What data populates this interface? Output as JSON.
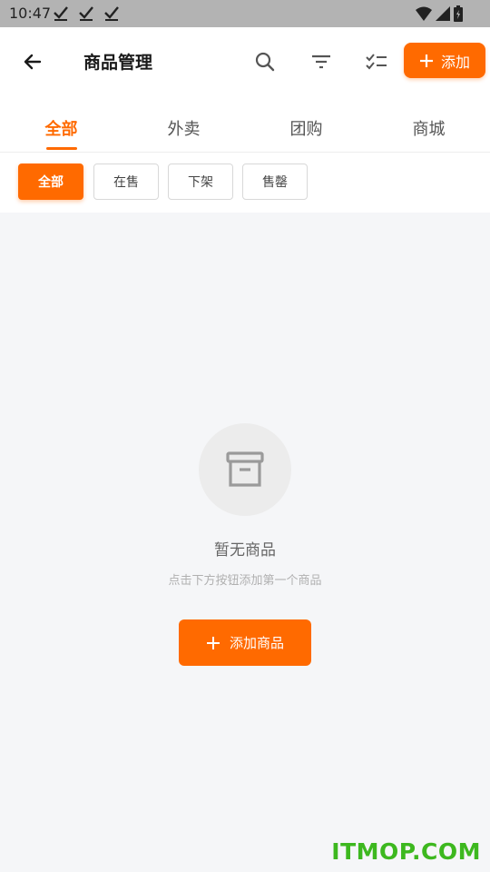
{
  "status_bar": {
    "time": "10:47",
    "check_icons": [
      "check-icon",
      "check-icon",
      "check-icon"
    ],
    "right_icons": [
      "wifi-icon",
      "signal-icon",
      "battery-icon"
    ]
  },
  "header": {
    "title": "商品管理",
    "add_label": "添加",
    "icons": [
      "back-arrow-icon",
      "search-icon",
      "filter-icon",
      "checklist-icon",
      "plus-icon"
    ]
  },
  "tabs": [
    {
      "label": "全部",
      "active": true
    },
    {
      "label": "外卖",
      "active": false
    },
    {
      "label": "团购",
      "active": false
    },
    {
      "label": "商城",
      "active": false
    }
  ],
  "filter_chips": [
    {
      "label": "全部",
      "active": true
    },
    {
      "label": "在售",
      "active": false
    },
    {
      "label": "下架",
      "active": false
    },
    {
      "label": "售罄",
      "active": false
    }
  ],
  "empty_state": {
    "icon": "archive-box-icon",
    "title": "暂无商品",
    "subtitle": "点击下方按钮添加第一个商品",
    "button_label": "添加商品"
  },
  "watermark": "ITMOP.COM",
  "colors": {
    "accent": "#ff6a00",
    "background": "#f5f6f8",
    "status_bar": "#b3b3b3",
    "watermark": "#3db81f"
  }
}
